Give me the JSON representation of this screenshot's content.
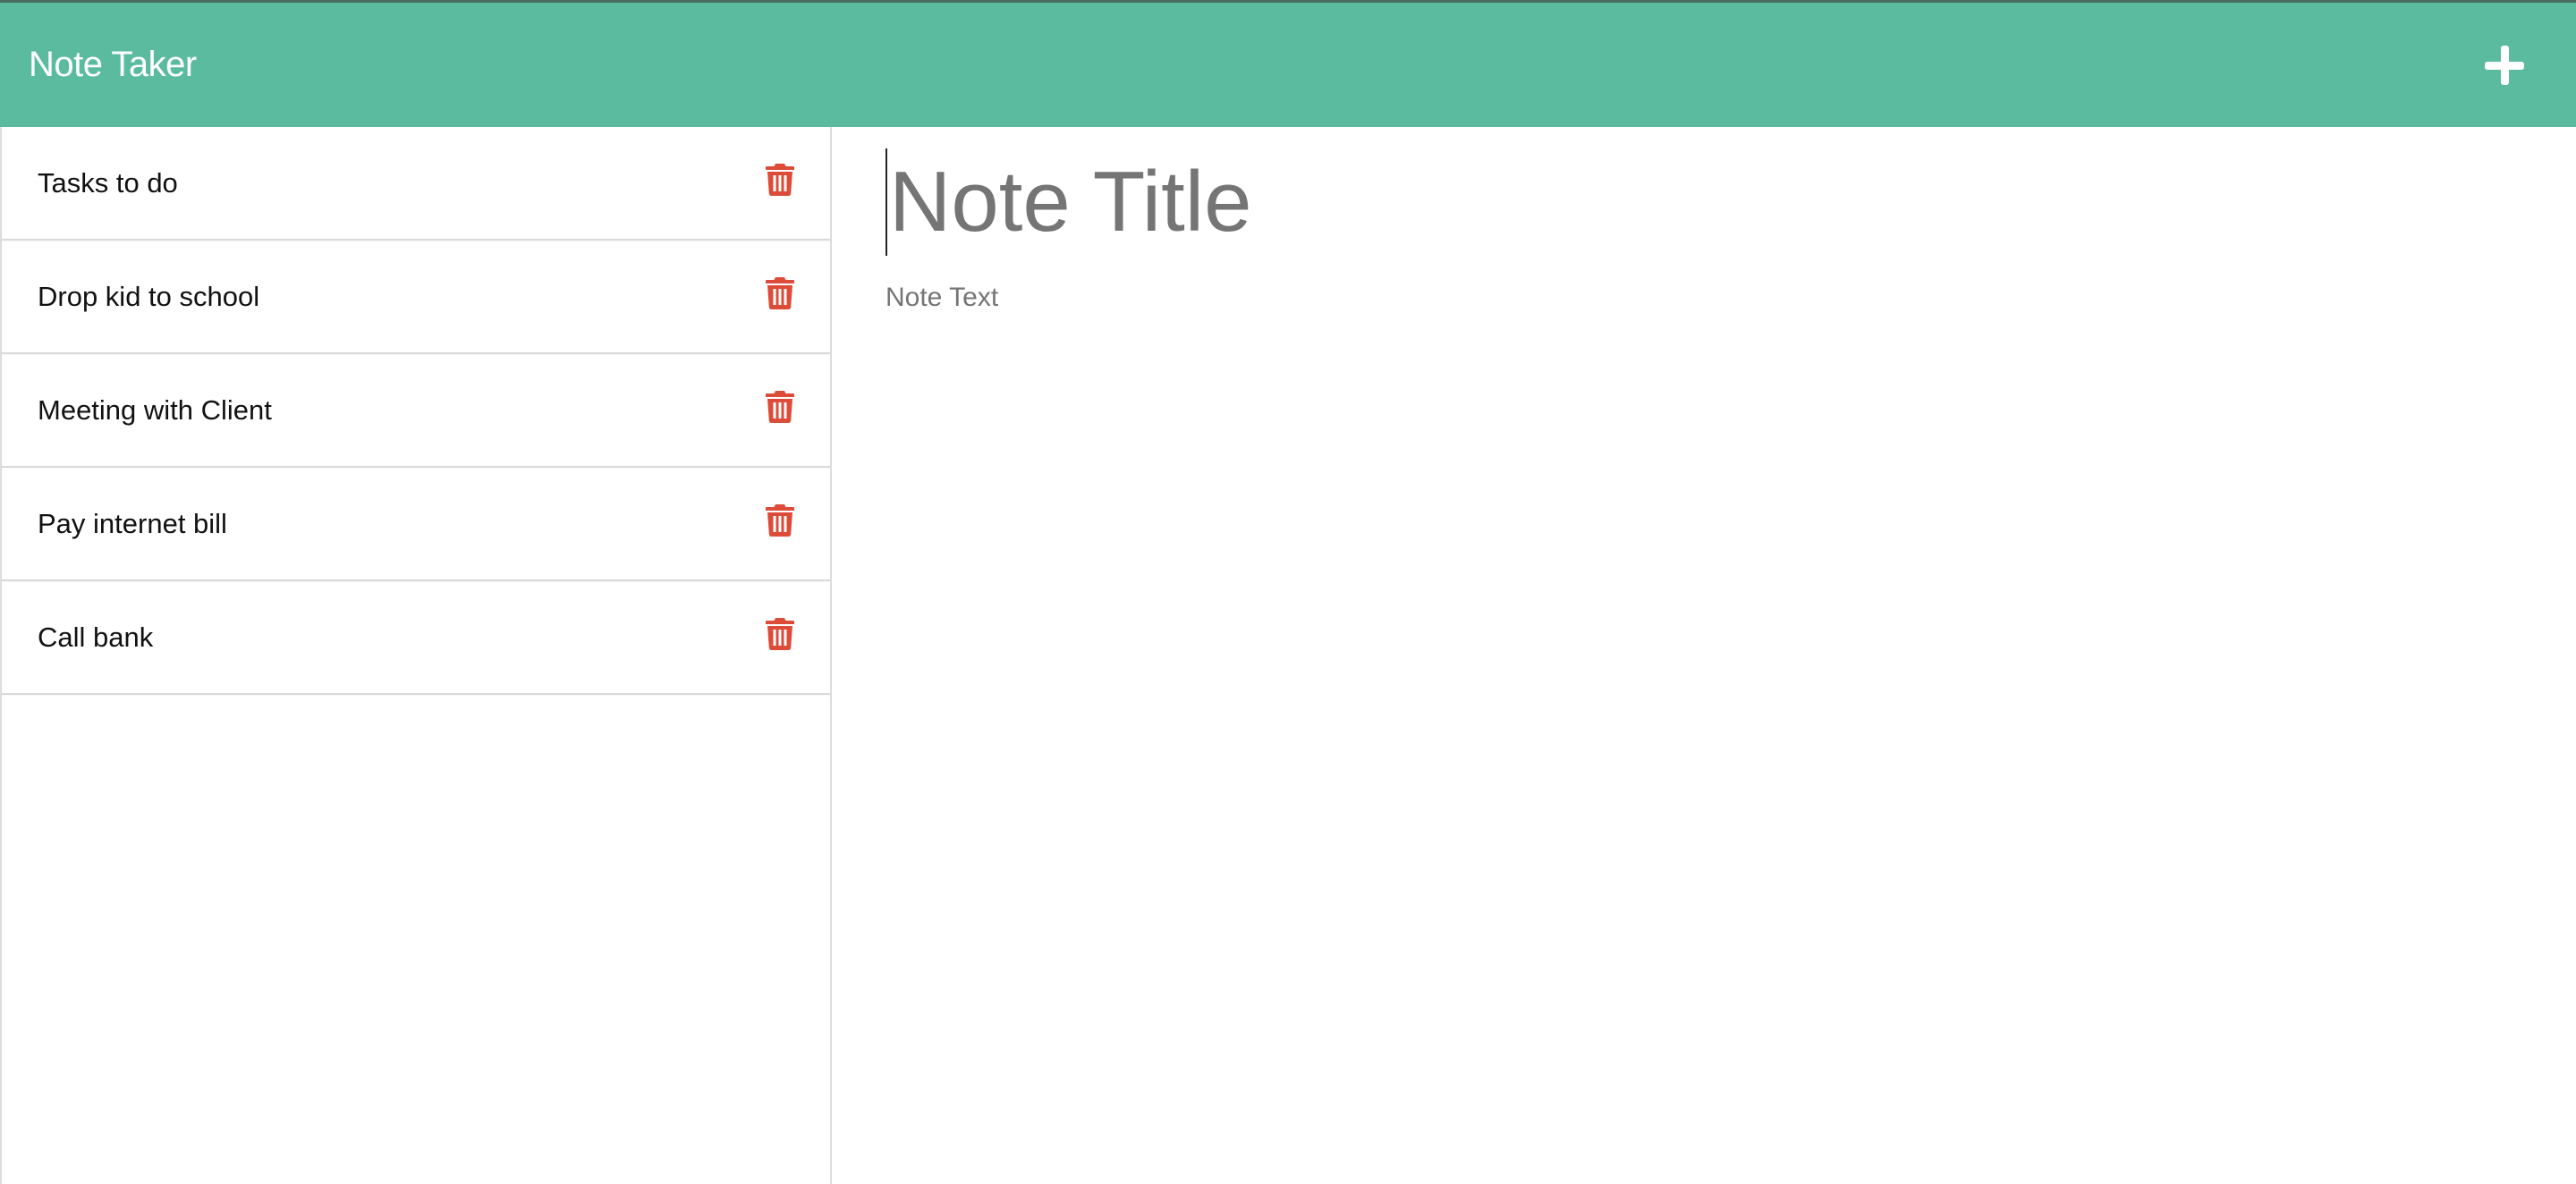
{
  "navbar": {
    "brand": "Note Taker",
    "new_note_icon": "plus-icon"
  },
  "sidebar": {
    "notes": [
      {
        "title": "Tasks to do",
        "icon": "trash-icon"
      },
      {
        "title": "Drop kid to school",
        "icon": "trash-icon"
      },
      {
        "title": "Meeting with Client",
        "icon": "trash-icon"
      },
      {
        "title": "Pay internet bill",
        "icon": "trash-icon"
      },
      {
        "title": "Call bank",
        "icon": "trash-icon"
      }
    ]
  },
  "editor": {
    "title_placeholder": "Note Title",
    "title_value": "",
    "text_placeholder": "Note Text",
    "text_value": ""
  },
  "colors": {
    "navbar_bg": "#5abb9f",
    "delete_icon": "#dd4b39",
    "placeholder": "#757575"
  }
}
